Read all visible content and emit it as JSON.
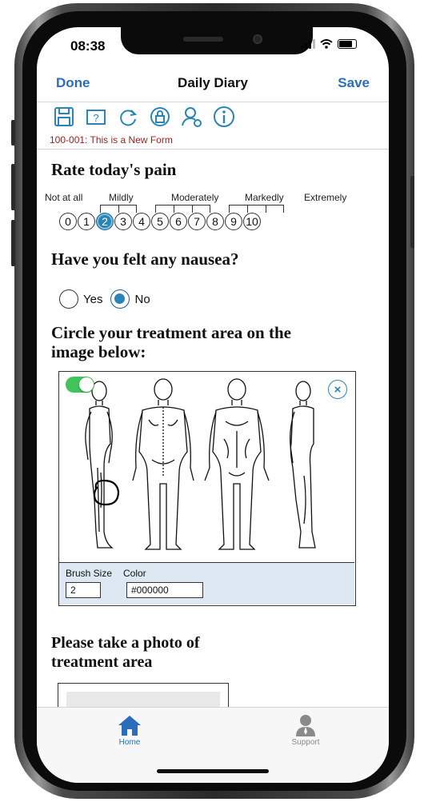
{
  "status": {
    "time": "08:38"
  },
  "nav": {
    "done": "Done",
    "title": "Daily Diary",
    "save": "Save"
  },
  "toolbar": {
    "icons": [
      "save-icon",
      "help-icon",
      "refresh-icon",
      "lock-icon",
      "user-settings-icon",
      "info-icon"
    ]
  },
  "form": {
    "id_text": "100-001: This is a New Form"
  },
  "pain": {
    "heading": "Rate today's pain",
    "labels": [
      "Not at all",
      "Mildly",
      "Moderately",
      "Markedly",
      "Extremely"
    ],
    "values": [
      "0",
      "1",
      "2",
      "3",
      "4",
      "5",
      "6",
      "7",
      "8",
      "9",
      "10"
    ],
    "selected": "2"
  },
  "nausea": {
    "heading": "Have you felt any nausea?",
    "options": [
      "Yes",
      "No"
    ],
    "selected": "No"
  },
  "treatment": {
    "heading_line1": "Circle your treatment area on the",
    "heading_line2": "image below:",
    "brush_size_label": "Brush Size",
    "color_label": "Color",
    "brush_size": "2",
    "color": "#000000",
    "draw_toggle_on": true
  },
  "photo": {
    "heading_line1": "Please take a photo of",
    "heading_line2": "treatment area"
  },
  "tabbar": {
    "home": "Home",
    "support": "Support"
  },
  "colors": {
    "accent": "#2a84b5",
    "link": "#2a6ebb",
    "form_id": "#9a1c1c",
    "panel": "#dde8f2",
    "toggle": "#3ec45a"
  }
}
